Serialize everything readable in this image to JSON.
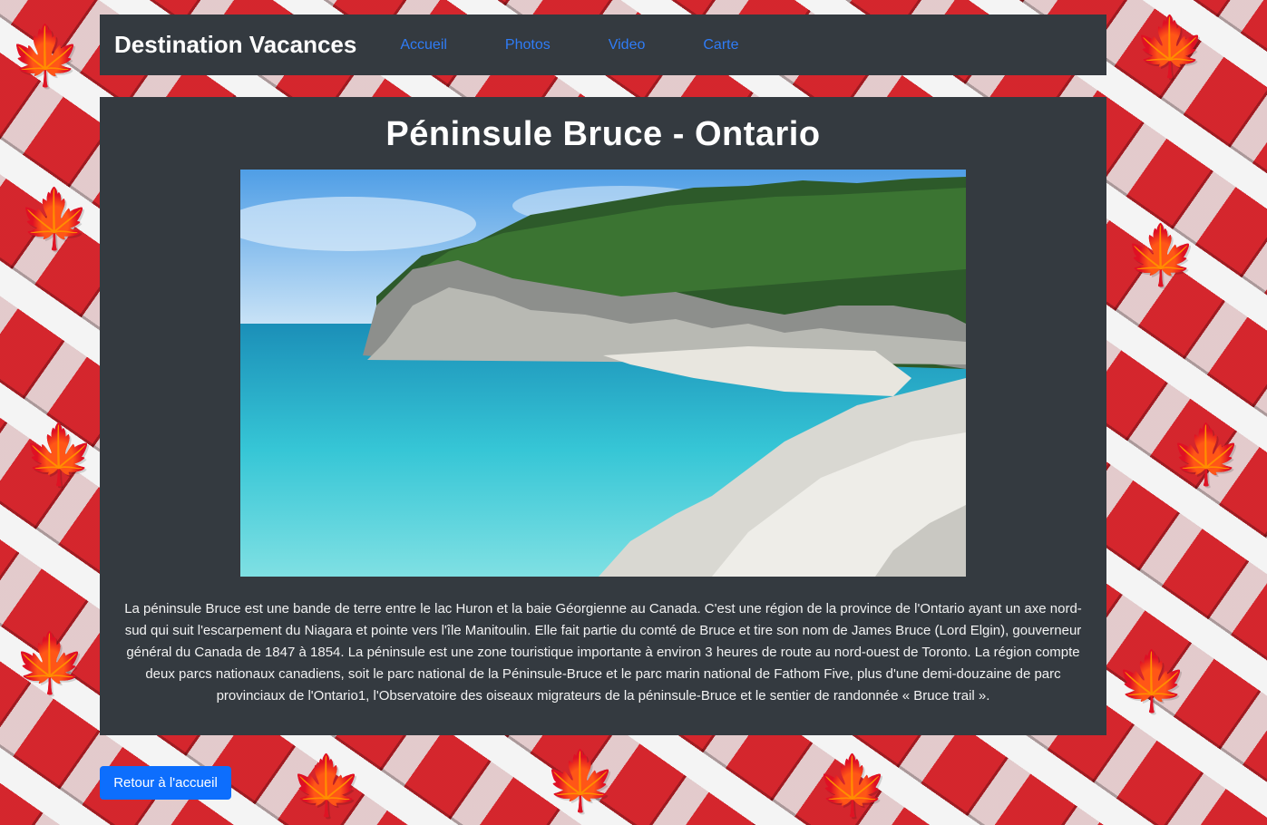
{
  "navbar": {
    "brand": "Destination Vacances",
    "links": [
      {
        "label": "Accueil"
      },
      {
        "label": "Photos"
      },
      {
        "label": "Video"
      },
      {
        "label": "Carte"
      }
    ],
    "link_color": "#2f7cf6",
    "background": "#343a40"
  },
  "main": {
    "title": "Péninsule Bruce - Ontario",
    "description": "La péninsule Bruce est une bande de terre entre le lac Huron et la baie Géorgienne au Canada. C'est une région de la province de l'Ontario ayant un axe nord-sud qui suit l'escarpement du Niagara et pointe vers l'île Manitoulin. Elle fait partie du comté de Bruce et tire son nom de James Bruce (Lord Elgin), gouverneur général du Canada de 1847 à 1854. La péninsule est une zone touristique importante à environ 3 heures de route au nord-ouest de Toronto. La région compte deux parcs nationaux canadiens, soit le parc national de la Péninsule-Bruce et le parc marin national de Fathom Five, plus d'une demi-douzaine de parc provinciaux de l'Ontario1, l'Observatoire des oiseaux migrateurs de la péninsule-Bruce et le sentier de randonnée « Bruce trail »."
  },
  "footer": {
    "back_button": "Retour à l'accueil",
    "button_color": "#0d6efd"
  },
  "background": {
    "icon": "canada-flag-pattern",
    "colors": [
      "#d7262d",
      "#ffffff"
    ]
  }
}
